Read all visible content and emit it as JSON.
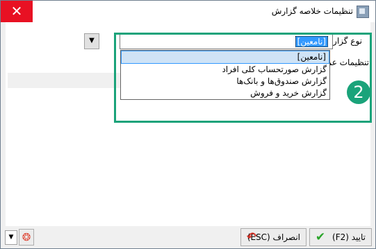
{
  "window": {
    "title": "تنظیمات خلاصه گزارش",
    "close_label": "✕"
  },
  "form": {
    "report_type_label": "نوع گزارش:",
    "report_type_value": "[نامعین]",
    "settings_label": "تنظیمات عم"
  },
  "dropdown": {
    "items": [
      "[نامعین]",
      "گزارش صورتحساب کلی افراد",
      "گزارش صندوق‌ها و بانک‌ها",
      "گزارش خرید و فروش"
    ]
  },
  "callout": {
    "number": "2",
    "color": "#1aa37a"
  },
  "footer": {
    "ok_label": "تایید (F2)",
    "cancel_label": "انصراف (ESC)"
  },
  "icons": {
    "ok": "checkmark-icon",
    "cancel": "undo-arrow-icon",
    "help": "lifebuoy-icon",
    "app": "app-icon",
    "combo_arrow": "chevron-down-icon"
  }
}
